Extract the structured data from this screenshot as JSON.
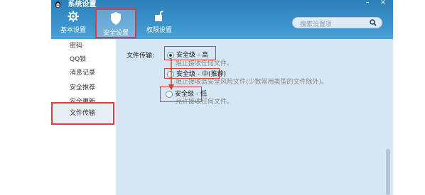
{
  "window": {
    "title": "系统设置",
    "minimize": "–",
    "close": "×"
  },
  "tabs": [
    {
      "label": "基本设置",
      "icon": "gear-icon",
      "active": false
    },
    {
      "label": "安全设置",
      "icon": "shield-icon",
      "active": true
    },
    {
      "label": "权限设置",
      "icon": "lock-icon",
      "active": false
    }
  ],
  "search": {
    "placeholder": "搜索设置项"
  },
  "sidebar": {
    "items": [
      {
        "label": "密码"
      },
      {
        "label": "QQ锁"
      },
      {
        "label": "消息记录"
      },
      {
        "label": "安全推荐"
      },
      {
        "label": "安全更新"
      },
      {
        "label": "文件传输",
        "active": true
      }
    ]
  },
  "file_transfer": {
    "label": "文件传输:",
    "options": [
      {
        "label": "安全级 - 高",
        "desc": "阻止接收任何文件。",
        "selected": true
      },
      {
        "label": "安全级 - 中(推荐)",
        "desc": "阻止接收高安全风险文件(少数常用类型的文件除外)。",
        "selected": false
      },
      {
        "label": "安全级 - 低",
        "desc": "允许接收任何文件。",
        "selected": false
      }
    ]
  },
  "colors": {
    "header": "#3a92cc",
    "content": "#d5e6f5",
    "highlight": "#e03a3a"
  }
}
